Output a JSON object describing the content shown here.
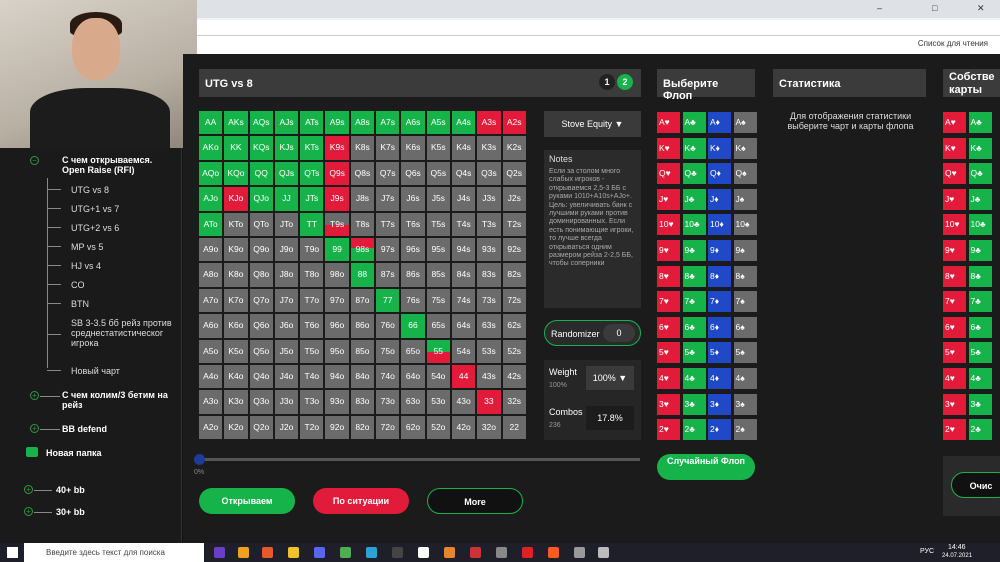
{
  "browser": {
    "bookmark_text": "Список для чтения"
  },
  "sidebar": {
    "section1": "С чем открываемся. Open Raise (RFI)",
    "items": [
      "UTG vs 8",
      "UTG+1 vs 7",
      "UTG+2 vs 6",
      "MP vs 5",
      "HJ vs 4",
      "CO",
      "BTN",
      "SB 3-3.5 бб рейз против среднестатистическог игрока",
      "Новый чарт"
    ],
    "section2": "С чем колим/3 бетим на рейз",
    "section3": "BB defend",
    "folder": "Новая папка",
    "f1": "40+ bb",
    "f2": "30+ bb"
  },
  "chart": {
    "title": "UTG vs 8",
    "tab1": "1",
    "tab2": "2",
    "rows": [
      [
        [
          "AA",
          "g"
        ],
        [
          "AKs",
          "g"
        ],
        [
          "AQs",
          "g"
        ],
        [
          "AJs",
          "g"
        ],
        [
          "ATs",
          "g"
        ],
        [
          "A9s",
          "g"
        ],
        [
          "A8s",
          "g"
        ],
        [
          "A7s",
          "g"
        ],
        [
          "A6s",
          "g"
        ],
        [
          "A5s",
          "g"
        ],
        [
          "A4s",
          "g"
        ],
        [
          "A3s",
          "r"
        ],
        [
          "A2s",
          "r"
        ]
      ],
      [
        [
          "AKo",
          "g"
        ],
        [
          "KK",
          "g"
        ],
        [
          "KQs",
          "g"
        ],
        [
          "KJs",
          "g"
        ],
        [
          "KTs",
          "g"
        ],
        [
          "K9s",
          "r"
        ],
        [
          "K8s",
          "n"
        ],
        [
          "K7s",
          "n"
        ],
        [
          "K6s",
          "n"
        ],
        [
          "K5s",
          "n"
        ],
        [
          "K4s",
          "n"
        ],
        [
          "K3s",
          "n"
        ],
        [
          "K2s",
          "n"
        ]
      ],
      [
        [
          "AQo",
          "g"
        ],
        [
          "KQo",
          "g"
        ],
        [
          "QQ",
          "g"
        ],
        [
          "QJs",
          "g"
        ],
        [
          "QTs",
          "g"
        ],
        [
          "Q9s",
          "r"
        ],
        [
          "Q8s",
          "n"
        ],
        [
          "Q7s",
          "n"
        ],
        [
          "Q6s",
          "n"
        ],
        [
          "Q5s",
          "n"
        ],
        [
          "Q4s",
          "n"
        ],
        [
          "Q3s",
          "n"
        ],
        [
          "Q2s",
          "n"
        ]
      ],
      [
        [
          "AJo",
          "g"
        ],
        [
          "KJo",
          "r"
        ],
        [
          "QJo",
          "g"
        ],
        [
          "JJ",
          "g"
        ],
        [
          "JTs",
          "g"
        ],
        [
          "J9s",
          "r"
        ],
        [
          "J8s",
          "n"
        ],
        [
          "J7s",
          "n"
        ],
        [
          "J6s",
          "n"
        ],
        [
          "J5s",
          "n"
        ],
        [
          "J4s",
          "n"
        ],
        [
          "J3s",
          "n"
        ],
        [
          "J2s",
          "n"
        ]
      ],
      [
        [
          "ATo",
          "g"
        ],
        [
          "KTo",
          "n"
        ],
        [
          "QTo",
          "n"
        ],
        [
          "JTo",
          "n"
        ],
        [
          "TT",
          "g"
        ],
        [
          "T9s",
          "hr"
        ],
        [
          "T8s",
          "n"
        ],
        [
          "T7s",
          "n"
        ],
        [
          "T6s",
          "n"
        ],
        [
          "T5s",
          "n"
        ],
        [
          "T4s",
          "n"
        ],
        [
          "T3s",
          "n"
        ],
        [
          "T2s",
          "n"
        ]
      ],
      [
        [
          "A9o",
          "n"
        ],
        [
          "K9o",
          "n"
        ],
        [
          "Q9o",
          "n"
        ],
        [
          "J9o",
          "n"
        ],
        [
          "T9o",
          "n"
        ],
        [
          "99",
          "g"
        ],
        [
          "98s",
          "hg"
        ],
        [
          "97s",
          "n"
        ],
        [
          "96s",
          "n"
        ],
        [
          "95s",
          "n"
        ],
        [
          "94s",
          "n"
        ],
        [
          "93s",
          "n"
        ],
        [
          "92s",
          "n"
        ]
      ],
      [
        [
          "A8o",
          "n"
        ],
        [
          "K8o",
          "n"
        ],
        [
          "Q8o",
          "n"
        ],
        [
          "J8o",
          "n"
        ],
        [
          "T8o",
          "n"
        ],
        [
          "98o",
          "n"
        ],
        [
          "88",
          "g"
        ],
        [
          "87s",
          "n"
        ],
        [
          "86s",
          "n"
        ],
        [
          "85s",
          "n"
        ],
        [
          "84s",
          "n"
        ],
        [
          "83s",
          "n"
        ],
        [
          "82s",
          "n"
        ]
      ],
      [
        [
          "A7o",
          "n"
        ],
        [
          "K7o",
          "n"
        ],
        [
          "Q7o",
          "n"
        ],
        [
          "J7o",
          "n"
        ],
        [
          "T7o",
          "n"
        ],
        [
          "97o",
          "n"
        ],
        [
          "87o",
          "n"
        ],
        [
          "77",
          "g"
        ],
        [
          "76s",
          "n"
        ],
        [
          "75s",
          "n"
        ],
        [
          "74s",
          "n"
        ],
        [
          "73s",
          "n"
        ],
        [
          "72s",
          "n"
        ]
      ],
      [
        [
          "A6o",
          "n"
        ],
        [
          "K6o",
          "n"
        ],
        [
          "Q6o",
          "n"
        ],
        [
          "J6o",
          "n"
        ],
        [
          "T6o",
          "n"
        ],
        [
          "96o",
          "n"
        ],
        [
          "86o",
          "n"
        ],
        [
          "76o",
          "n"
        ],
        [
          "66",
          "g"
        ],
        [
          "65s",
          "n"
        ],
        [
          "64s",
          "n"
        ],
        [
          "63s",
          "n"
        ],
        [
          "62s",
          "n"
        ]
      ],
      [
        [
          "A5o",
          "n"
        ],
        [
          "K5o",
          "n"
        ],
        [
          "Q5o",
          "n"
        ],
        [
          "J5o",
          "n"
        ],
        [
          "T5o",
          "n"
        ],
        [
          "95o",
          "n"
        ],
        [
          "85o",
          "n"
        ],
        [
          "75o",
          "n"
        ],
        [
          "65o",
          "n"
        ],
        [
          "55",
          "hr"
        ],
        [
          "54s",
          "n"
        ],
        [
          "53s",
          "n"
        ],
        [
          "52s",
          "n"
        ]
      ],
      [
        [
          "A4o",
          "n"
        ],
        [
          "K4o",
          "n"
        ],
        [
          "Q4o",
          "n"
        ],
        [
          "J4o",
          "n"
        ],
        [
          "T4o",
          "n"
        ],
        [
          "94o",
          "n"
        ],
        [
          "84o",
          "n"
        ],
        [
          "74o",
          "n"
        ],
        [
          "64o",
          "n"
        ],
        [
          "54o",
          "n"
        ],
        [
          "44",
          "r"
        ],
        [
          "43s",
          "n"
        ],
        [
          "42s",
          "n"
        ]
      ],
      [
        [
          "A3o",
          "n"
        ],
        [
          "K3o",
          "n"
        ],
        [
          "Q3o",
          "n"
        ],
        [
          "J3o",
          "n"
        ],
        [
          "T3o",
          "n"
        ],
        [
          "93o",
          "n"
        ],
        [
          "83o",
          "n"
        ],
        [
          "73o",
          "n"
        ],
        [
          "63o",
          "n"
        ],
        [
          "53o",
          "n"
        ],
        [
          "43o",
          "n"
        ],
        [
          "33",
          "r"
        ],
        [
          "32s",
          "n"
        ]
      ],
      [
        [
          "A2o",
          "n"
        ],
        [
          "K2o",
          "n"
        ],
        [
          "Q2o",
          "n"
        ],
        [
          "J2o",
          "n"
        ],
        [
          "T2o",
          "n"
        ],
        [
          "92o",
          "n"
        ],
        [
          "82o",
          "n"
        ],
        [
          "72o",
          "n"
        ],
        [
          "62o",
          "n"
        ],
        [
          "52o",
          "n"
        ],
        [
          "42o",
          "n"
        ],
        [
          "32o",
          "n"
        ],
        [
          "22",
          "n"
        ]
      ]
    ]
  },
  "controls": {
    "equity": "Stove Equity ▼",
    "note_title": "Notes",
    "note_body": "Если за столом много слабых игроков - открываемся 2,5-3 ББ с руками 1010+A10s+AJo+. Цель: увеличивать банк с лучшими руками против доминированных. Если есть понимающие игроки, то лучше всегда открываться одним размером рейза 2-2,5 ББ, чтобы соперники",
    "randomizer": "Randomizer",
    "randomizer_val": "0",
    "weight": "Weight",
    "weight_sub": "100%",
    "weight_val": "100% ▼",
    "combos": "Combos",
    "combos_sub": "236",
    "combos_val": "17.8%",
    "slider_label": "0%"
  },
  "buttons": {
    "open": "Открываем",
    "situation": "По ситуации",
    "more": "More"
  },
  "flop": {
    "title": "Выберите Флоп",
    "random": "Случайный Флоп",
    "ranks": [
      "A",
      "K",
      "Q",
      "J",
      "10",
      "9",
      "8",
      "7",
      "6",
      "5",
      "4",
      "3",
      "2"
    ],
    "suits": [
      "♥",
      "♣",
      "♦",
      "♠"
    ]
  },
  "stats": {
    "title": "Статистика",
    "text": "Для отображения статистики выберите чарт и карты флопа"
  },
  "own": {
    "title": "Собстве карты",
    "clear": "Очис"
  },
  "taskbar": {
    "search": "Введите здесь текст для поиска",
    "lang": "РУС",
    "time": "14:46",
    "date": "24.07.2021"
  }
}
